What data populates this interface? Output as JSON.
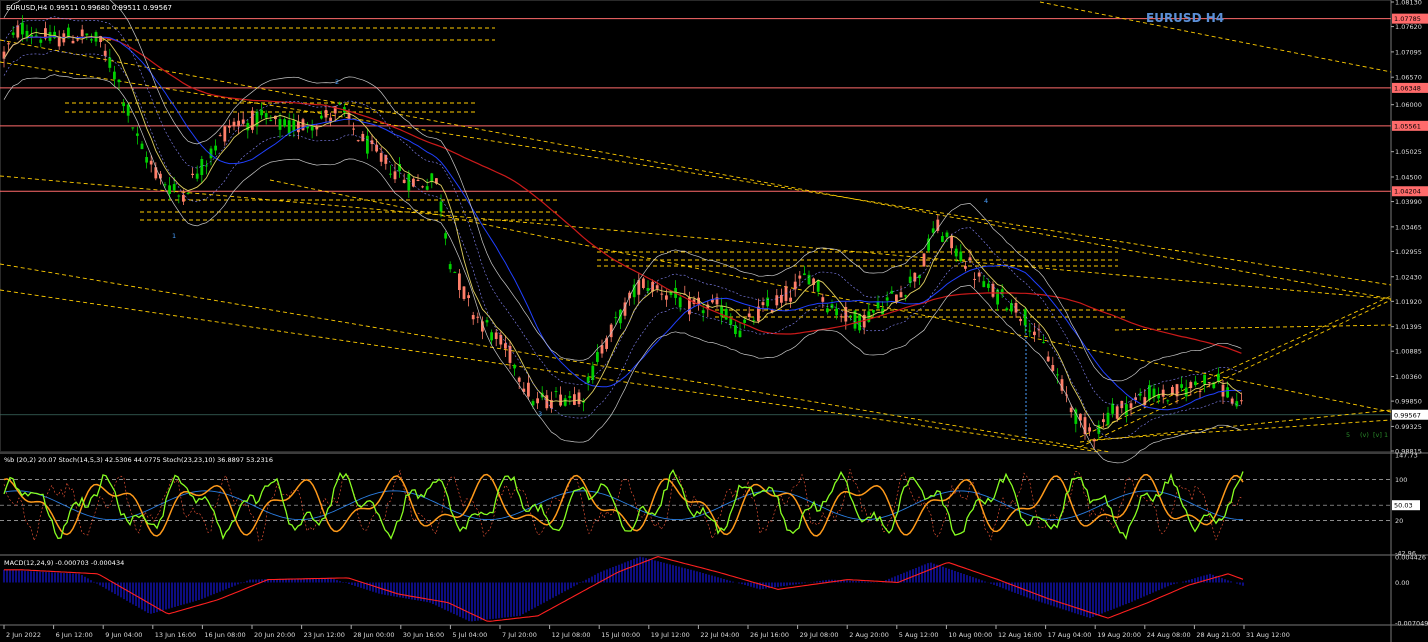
{
  "window": {
    "header": "EURUSD,H4  0.99511 0.99680 0.99511 0.99567",
    "watermark": "EURUSD H4"
  },
  "colors": {
    "background": "#000000",
    "bull": "#00d000",
    "bear": "#ff7f6a",
    "ma_long": "#cc1a1a",
    "ma_mid": "#2040ff",
    "ma_fast": "#e0d060",
    "bands": "#c8c8c8",
    "levels": "#ff6b6b",
    "trend": "#ffcc00",
    "stoch_main": "#88ff22",
    "stoch_slow": "#ff9a1a",
    "stoch_sig": "#2a7de0",
    "macd_hist": "#1a1aff",
    "macd_signal": "#ff2020"
  },
  "price_axis": {
    "labels": [
      "1.08130",
      "1.07620",
      "1.07095",
      "1.06570",
      "1.06000",
      "1.05025",
      "1.04500",
      "1.03990",
      "1.03465",
      "1.02955",
      "1.02430",
      "1.01920",
      "1.01395",
      "1.00885",
      "1.00360",
      "0.99850",
      "0.99325",
      "0.98815"
    ],
    "min": 0.98815,
    "max": 1.0813
  },
  "levels": [
    {
      "label": "1.07785",
      "value": 1.07785
    },
    {
      "label": "1.06348",
      "value": 1.06348
    },
    {
      "label": "1.05561",
      "value": 1.05561
    },
    {
      "label": "1.04204",
      "value": 1.04204
    }
  ],
  "current_price": {
    "label": "0.99567",
    "value": 0.99567
  },
  "wave_labels": [
    "1",
    "2",
    "3",
    "4",
    "5",
    "(v)",
    "[v]",
    "1"
  ],
  "time_axis": [
    "2 Jun 2022",
    "6 Jun 12:00",
    "9 Jun 04:00",
    "13 Jun 16:00",
    "16 Jun 08:00",
    "20 Jun 20:00",
    "23 Jun 12:00",
    "28 Jun 00:00",
    "30 Jun 16:00",
    "5 Jul 04:00",
    "7 Jul 20:00",
    "12 Jul 08:00",
    "15 Jul 00:00",
    "19 Jul 12:00",
    "22 Jul 04:00",
    "26 Jul 16:00",
    "29 Jul 08:00",
    "2 Aug 20:00",
    "5 Aug 12:00",
    "10 Aug 00:00",
    "12 Aug 16:00",
    "17 Aug 04:00",
    "19 Aug 20:00",
    "24 Aug 08:00",
    "28 Aug 21:00",
    "31 Aug 12:00"
  ],
  "stoch_panel": {
    "header": "%b (20,2) 20.07  Stoch(14,5,3) 42.5306 44.0775  Stoch(23,23,10) 36.8897 53.2316",
    "labels": [
      "147.73",
      "50.03",
      "100",
      "20",
      "-42.96"
    ],
    "value_box": "50.03"
  },
  "macd_panel": {
    "header": "MACD(12,24,9) -0.000703 -0.000434",
    "labels": [
      "0.004426",
      "0.00",
      "-0.007049"
    ]
  },
  "chart_data": {
    "type": "line",
    "title": "EURUSD H4",
    "x": [
      "2 Jun 2022",
      "6 Jun 12:00",
      "9 Jun 04:00",
      "13 Jun 16:00",
      "16 Jun 08:00",
      "20 Jun 20:00",
      "23 Jun 12:00",
      "28 Jun 00:00",
      "30 Jun 16:00",
      "5 Jul 04:00",
      "7 Jul 20:00",
      "12 Jul 08:00",
      "15 Jul 00:00",
      "19 Jul 12:00",
      "22 Jul 04:00",
      "26 Jul 16:00",
      "29 Jul 08:00",
      "2 Aug 20:00",
      "5 Aug 12:00",
      "10 Aug 00:00",
      "12 Aug 16:00",
      "17 Aug 04:00",
      "19 Aug 20:00",
      "24 Aug 08:00",
      "28 Aug 21:00",
      "31 Aug 12:00"
    ],
    "series": [
      {
        "values": [
          1.0715,
          1.073,
          1.072,
          1.045,
          1.05,
          1.052,
          1.054,
          1.055,
          1.046,
          1.04,
          1.019,
          1.008,
          1.012,
          1.026,
          1.021,
          1.018,
          1.022,
          1.021,
          1.023,
          1.034,
          1.027,
          1.017,
          0.995,
          0.998,
          1.002,
          0.9957
        ]
      }
    ],
    "ylim": [
      0.98815,
      1.0813
    ]
  }
}
